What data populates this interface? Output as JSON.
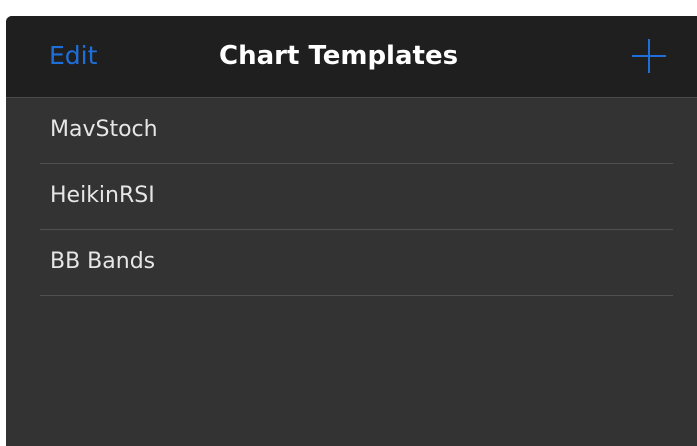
{
  "header": {
    "edit_label": "Edit",
    "title": "Chart Templates",
    "add_icon": "plus-icon"
  },
  "colors": {
    "accent": "#1e6fd9",
    "background": "#333333",
    "header_background": "#1f1f1f",
    "text": "#e6e6e6"
  },
  "templates": [
    {
      "label": "MavStoch"
    },
    {
      "label": "HeikinRSI"
    },
    {
      "label": "BB Bands"
    }
  ]
}
